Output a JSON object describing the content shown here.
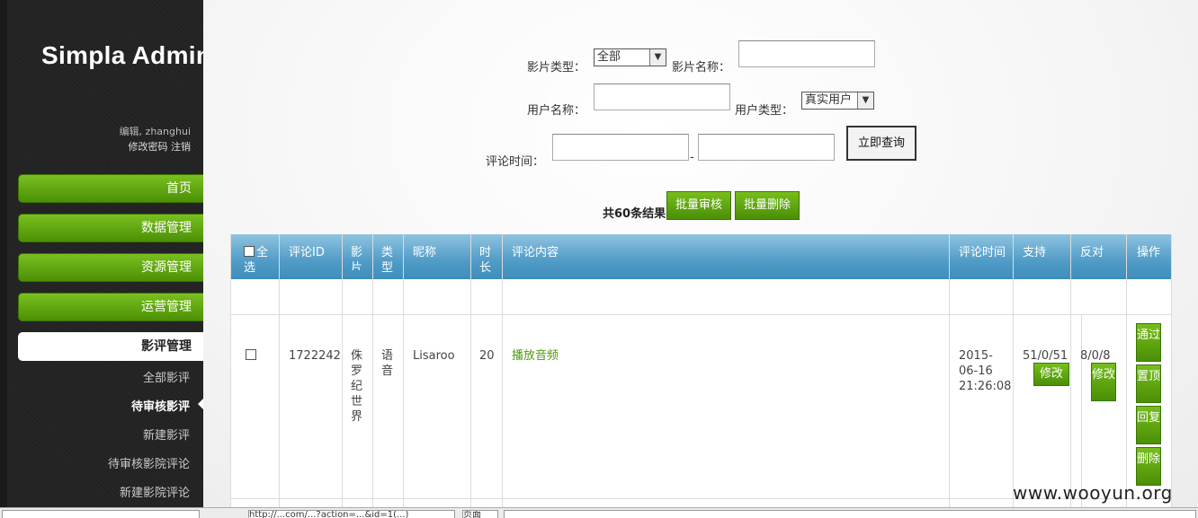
{
  "sidebar": {
    "brand": "Simpla Admin",
    "profile_line": "编辑, zhanghui",
    "link_password": "修改密码",
    "link_logout": "注销",
    "nav": [
      "首页",
      "数据管理",
      "资源管理",
      "运营管理",
      "影评管理"
    ],
    "sub": [
      "全部影评",
      "待审核影评",
      "新建影评",
      "待审核影院评论",
      "新建影院评论"
    ]
  },
  "filters": {
    "movie_type_label": "影片类型：",
    "movie_type_value": "全部",
    "movie_name_label": "影片名称：",
    "user_name_label": "用户名称：",
    "user_type_label": "用户类型：",
    "user_type_value": "真实用户",
    "comment_time_label": "评论时间：",
    "dash": "-",
    "query_button": "立即查询"
  },
  "toolbar": {
    "result_count": "共60条结果",
    "batch_approve": "批量审核",
    "batch_delete": "批量删除"
  },
  "table": {
    "headers": {
      "select_all": "全选",
      "comment_id": "评论ID",
      "movie": "影片名",
      "type": "类型",
      "nickname": "昵称",
      "duration": "时长",
      "content": "评论内容",
      "time": "评论时间",
      "support": "支持",
      "oppose": "反对",
      "action": "操作"
    },
    "row": {
      "comment_id": "1722242",
      "movie": "侏罗纪世界",
      "type": "语音",
      "nickname": "Lisaroo",
      "duration": "20",
      "content": "播放音频",
      "time": "2015-06-16 21:26:08",
      "support": "51/0/51",
      "support_edit": "修改",
      "oppose": "8/0/8",
      "oppose_edit": "修改",
      "act_pass": "通过",
      "act_top": "置顶",
      "act_reply": "回复",
      "act_delete": "删除"
    }
  },
  "watermark": "www.wooyun.org",
  "statusbar": {
    "url_fragment": "http://...com/...?action=...&id=1(...)",
    "zoom": "页面"
  }
}
